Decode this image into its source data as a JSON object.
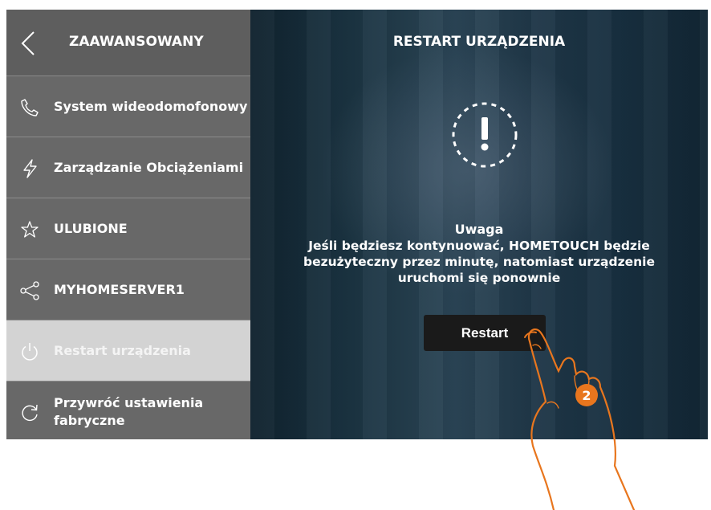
{
  "sidebar": {
    "title": "ZAAWANSOWANY",
    "items": [
      {
        "label": "System wideodomofonowy",
        "icon": "phone-icon"
      },
      {
        "label": "Zarządzanie Obciążeniami",
        "icon": "lightning-icon"
      },
      {
        "label": "ULUBIONE",
        "icon": "star-icon"
      },
      {
        "label": "MYHOMESERVER1",
        "icon": "share-icon"
      },
      {
        "label": "Restart urządzenia",
        "icon": "power-icon",
        "active": true
      },
      {
        "label": "Przywróć ustawienia fabryczne",
        "icon": "refresh-icon"
      }
    ]
  },
  "main": {
    "title": "RESTART URZĄDZENIA",
    "warning_heading": "Uwaga",
    "warning_text": "Jeśli będziesz kontynuować, HOMETOUCH będzie bezużyteczny przez minutę, natomiast urządzenie uruchomi się ponownie",
    "restart_button": "Restart"
  },
  "annotation": {
    "step": "2"
  },
  "colors": {
    "sidebar_bg": "#686868",
    "active_item_bg": "#d3d3d3",
    "button_bg": "#1a1a1a",
    "badge": "#e8761e"
  }
}
